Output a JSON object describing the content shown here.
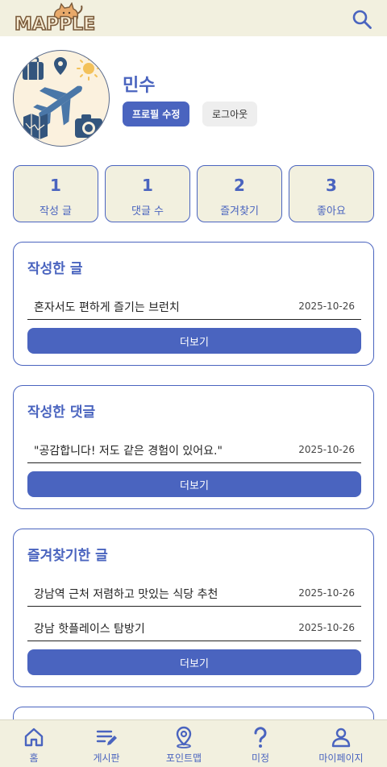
{
  "header": {
    "logo_text": "MAPPLE",
    "search_icon": "search-icon"
  },
  "profile": {
    "avatar_icon": "travel-avatar-icon",
    "name": "민수",
    "edit_label": "프로필 수정",
    "logout_label": "로그아웃"
  },
  "stats": [
    {
      "value": "1",
      "label": "작성 글"
    },
    {
      "value": "1",
      "label": "댓글 수"
    },
    {
      "value": "2",
      "label": "즐겨찾기"
    },
    {
      "value": "3",
      "label": "좋아요"
    }
  ],
  "sections": {
    "posts": {
      "title": "작성한 글",
      "items": [
        {
          "title": "혼자서도 편하게 즐기는 브런치",
          "date": "2025-10-26"
        }
      ],
      "more_label": "더보기"
    },
    "comments": {
      "title": "작성한 댓글",
      "items": [
        {
          "title": "\"공감합니다! 저도 같은 경험이 있어요.\"",
          "date": "2025-10-26"
        }
      ],
      "more_label": "더보기"
    },
    "bookmarks": {
      "title": "즐겨찾기한 글",
      "items": [
        {
          "title": "강남역 근처 저렴하고 맛있는 식당 추천",
          "date": "2025-10-26"
        },
        {
          "title": "강남 핫플레이스 탐방기",
          "date": "2025-10-26"
        }
      ],
      "more_label": "더보기"
    }
  },
  "nav": [
    {
      "label": "홈",
      "icon": "home-icon"
    },
    {
      "label": "게시판",
      "icon": "board-icon"
    },
    {
      "label": "포인트맵",
      "icon": "map-pin-icon"
    },
    {
      "label": "미정",
      "icon": "question-icon"
    },
    {
      "label": "마이페이지",
      "icon": "user-icon"
    }
  ],
  "colors": {
    "accent": "#4a64bf",
    "cream": "#f2f0df",
    "text": "#222222"
  }
}
